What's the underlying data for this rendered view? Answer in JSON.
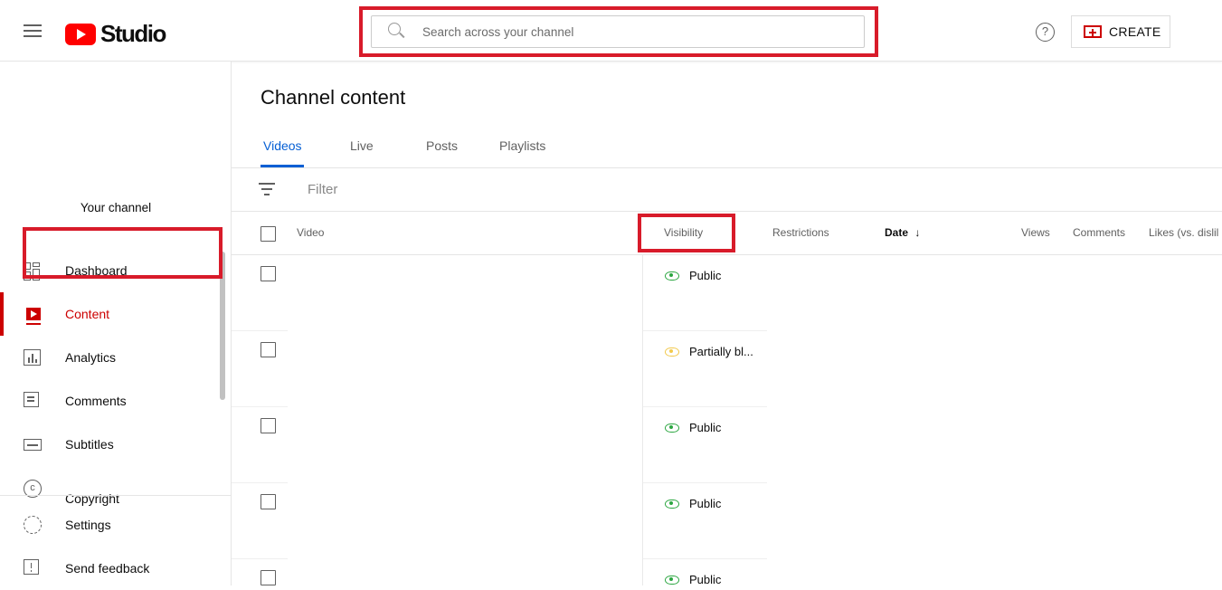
{
  "header": {
    "logo_text": "Studio",
    "search_placeholder": "Search across your channel",
    "help_symbol": "?",
    "create_label": "CREATE"
  },
  "sidebar": {
    "your_channel": "Your channel",
    "items": [
      {
        "label": "Dashboard",
        "icon": "dashboard-icon"
      },
      {
        "label": "Content",
        "icon": "content-icon",
        "active": true
      },
      {
        "label": "Analytics",
        "icon": "analytics-icon"
      },
      {
        "label": "Comments",
        "icon": "comments-icon"
      },
      {
        "label": "Subtitles",
        "icon": "subtitles-icon"
      },
      {
        "label": "Copyright",
        "icon": "copyright-icon"
      }
    ],
    "bottom_items": [
      {
        "label": "Settings",
        "icon": "gear-icon"
      },
      {
        "label": "Send feedback",
        "icon": "feedback-icon"
      }
    ]
  },
  "main": {
    "title": "Channel content",
    "tabs": [
      "Videos",
      "Live",
      "Posts",
      "Playlists"
    ],
    "active_tab": "Videos",
    "filter_placeholder": "Filter",
    "columns": {
      "video": "Video",
      "visibility": "Visibility",
      "restrictions": "Restrictions",
      "date": "Date",
      "views": "Views",
      "comments": "Comments",
      "likes": "Likes (vs. dislil"
    },
    "rows": [
      {
        "visibility": "Public",
        "status": "public"
      },
      {
        "visibility": "Partially bl...",
        "status": "partial"
      },
      {
        "visibility": "Public",
        "status": "public"
      },
      {
        "visibility": "Public",
        "status": "public"
      },
      {
        "visibility": "Public",
        "status": "public"
      }
    ]
  },
  "colors": {
    "accent_red": "#cc0000",
    "highlight_red": "#d81b2a",
    "tab_blue": "#065fd4",
    "public_green": "#2ba640",
    "partial_yellow": "#f2c94c"
  }
}
